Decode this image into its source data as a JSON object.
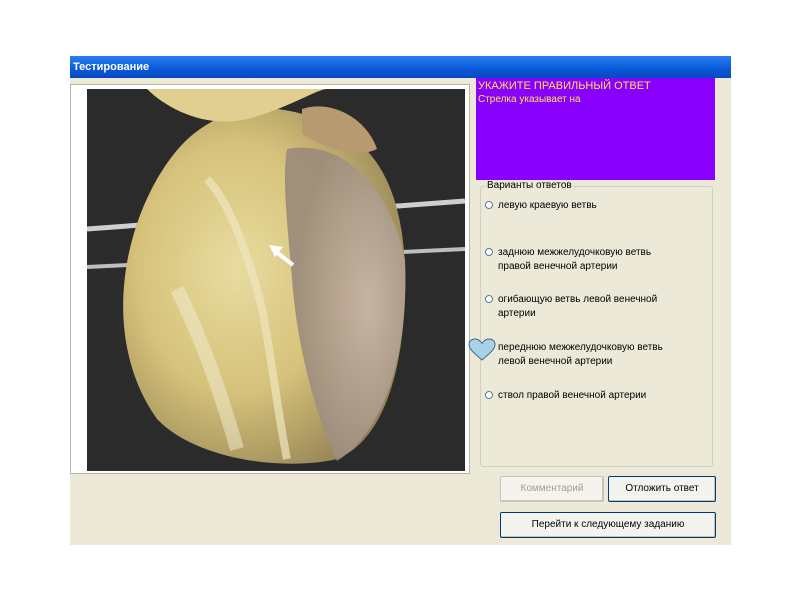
{
  "window": {
    "title": "Тестирование"
  },
  "question": {
    "heading": "УКАЖИТЕ ПРАВИЛЬНЫЙ ОТВЕТ",
    "text": "Стрелка указывает на"
  },
  "answers": {
    "legend": "Варианты ответов",
    "options": [
      {
        "label": "левую краевую ветвь"
      },
      {
        "label": "заднюю межжелудочковую ветвь\nправой венечной артерии"
      },
      {
        "label": "огибающую ветвь левой венечной\nартерии"
      },
      {
        "label": "переднюю межжелудочковую ветвь\nлевой венечной артерии"
      },
      {
        "label": "ствол правой венечной артерии"
      }
    ]
  },
  "buttons": {
    "comment": "Комментарий",
    "postpone": "Отложить ответ",
    "next": "Перейти к следующему заданию"
  },
  "colors": {
    "question_bg": "#8800ff",
    "question_text": "#ffe24a",
    "title_bar": "#0a58d8"
  }
}
